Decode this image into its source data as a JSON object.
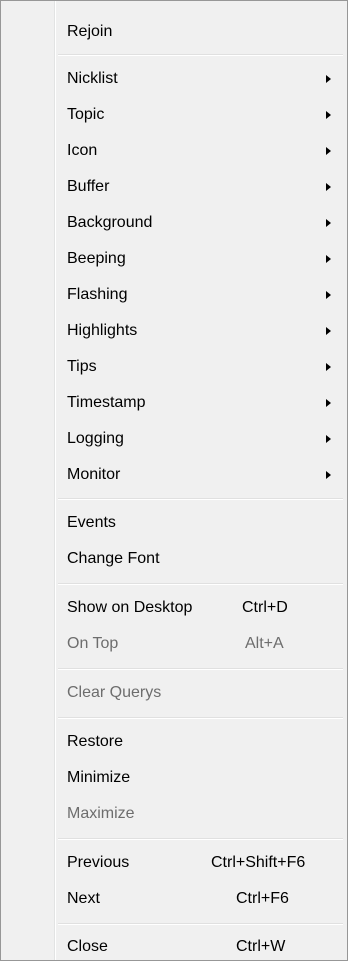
{
  "menu": {
    "items": [
      {
        "label": "Rejoin"
      },
      {
        "label": "Nicklist"
      },
      {
        "label": "Topic"
      },
      {
        "label": "Icon"
      },
      {
        "label": "Buffer"
      },
      {
        "label": "Background"
      },
      {
        "label": "Beeping"
      },
      {
        "label": "Flashing"
      },
      {
        "label": "Highlights"
      },
      {
        "label": "Tips"
      },
      {
        "label": "Timestamp"
      },
      {
        "label": "Logging"
      },
      {
        "label": "Monitor"
      },
      {
        "label": "Events"
      },
      {
        "label": "Change Font"
      },
      {
        "label": "Show on Desktop",
        "shortcut": "Ctrl+D"
      },
      {
        "label": "On Top",
        "shortcut": "Alt+A",
        "disabled": true
      },
      {
        "label": "Clear Querys",
        "disabled": true
      },
      {
        "label": "Restore"
      },
      {
        "label": "Minimize"
      },
      {
        "label": "Maximize",
        "disabled": true
      },
      {
        "label": "Previous",
        "shortcut": "Ctrl+Shift+F6"
      },
      {
        "label": "Next",
        "shortcut": "Ctrl+F6"
      },
      {
        "label": "Close",
        "shortcut": "Ctrl+W"
      }
    ]
  },
  "colors": {
    "menu_background": "#f0f0f0",
    "border": "#979797",
    "text": "#000000",
    "disabled_text": "#6d6d6d",
    "separator": "#e0e0e0"
  },
  "icons": {
    "submenu": "submenu-arrow-icon"
  }
}
